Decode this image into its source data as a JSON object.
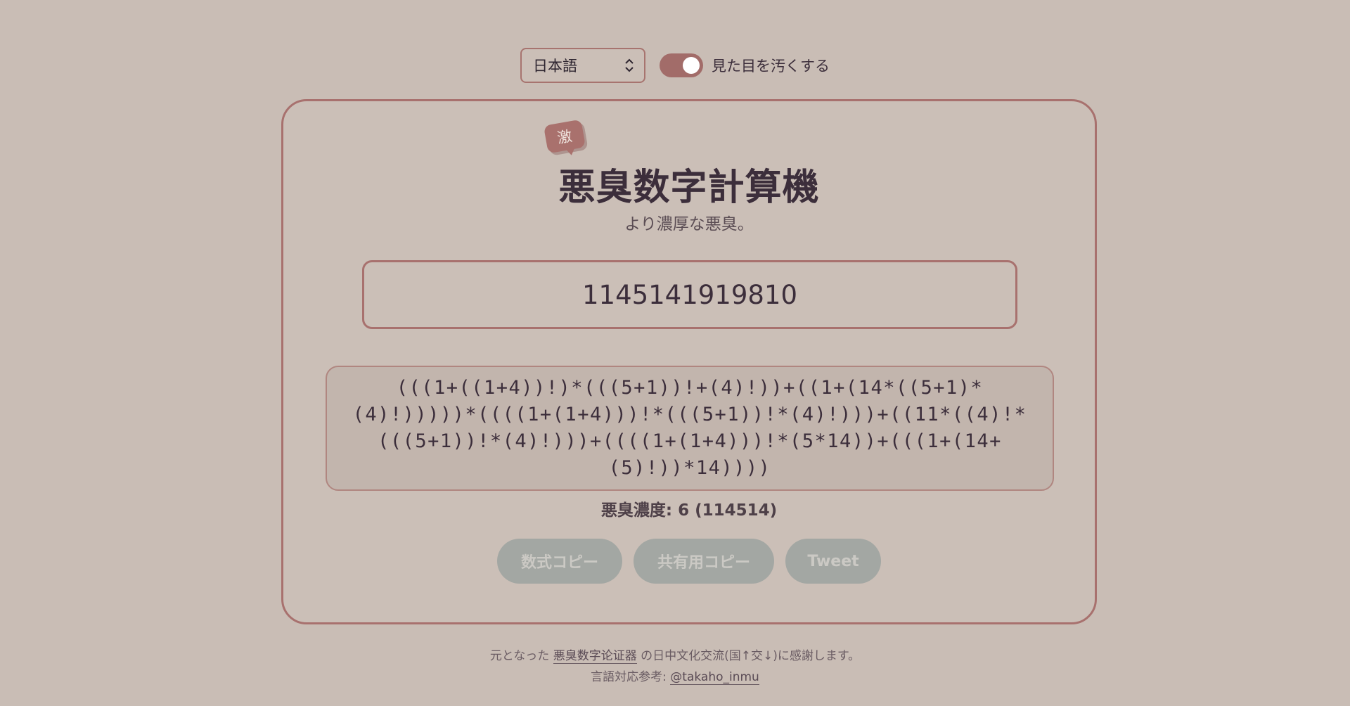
{
  "controls": {
    "language_selected": "日本語",
    "toggle_label": "見た目を汚くする",
    "toggle_on": true
  },
  "header": {
    "badge": "激",
    "title": "悪臭数字計算機",
    "subtitle": "より濃厚な悪臭。"
  },
  "input": {
    "value": "1145141919810"
  },
  "result": {
    "expression": "(((1+((1+4))!)*(((5+1))!+(4)!))+((1+(14*((5+1)*(4)!)))))*((((1+(1+4)))!*(((5+1))!*(4)!)))+((11*((4)!*(((5+1))!*(4)!)))+((((1+(1+4)))!*(5*14))+(((1+(14+(5)!))*14))))",
    "density": "悪臭濃度: 6 (114514)"
  },
  "buttons": {
    "copy_formula": "数式コピー",
    "copy_share": "共有用コピー",
    "tweet": "Tweet"
  },
  "footer": {
    "line1_prefix": "元となった",
    "line1_link": "悪臭数字论证器",
    "line1_suffix": "の日中文化交流(国↑交↓)に感謝します。",
    "line2_prefix": "言語対応参考:",
    "line2_link": "@takaho_inmu"
  },
  "colors": {
    "background": "#c9bdb5",
    "accent": "#a8716e",
    "text": "#3c2e3b",
    "button_disabled": "#a3a7a3"
  }
}
